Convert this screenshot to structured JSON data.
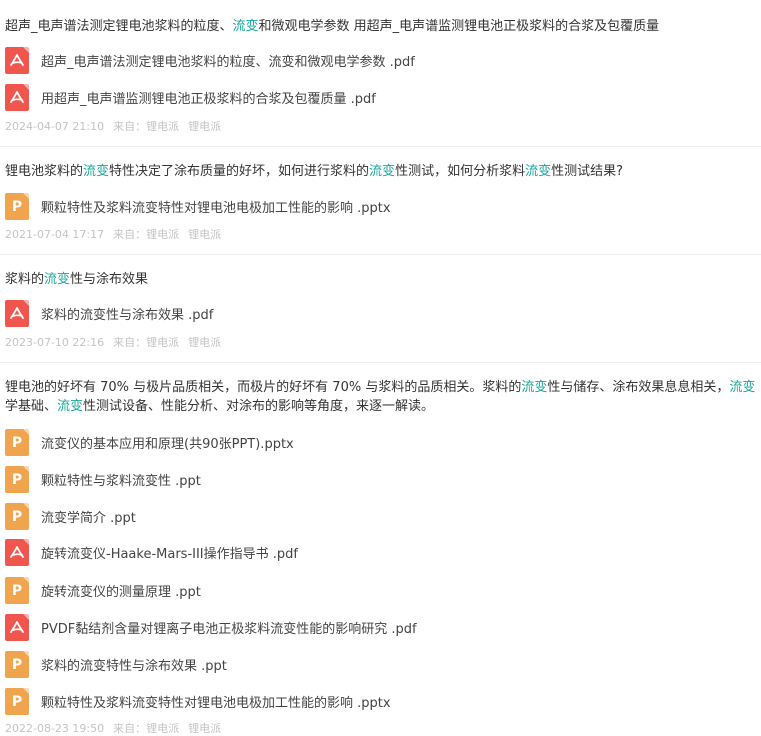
{
  "items": [
    {
      "title_parts": [
        "超声_电声谱法测定锂电池浆料的粒度、",
        "流变",
        "和微观电学参数 用超声_电声谱监测锂电池正极浆料的合浆及包覆质量"
      ],
      "files": [
        {
          "type": "pdf",
          "icon": "pdf-file-icon",
          "name": "超声_电声谱法测定锂电池浆料的粒度、流变和微观电学参数 .pdf"
        },
        {
          "type": "pdf",
          "icon": "pdf-file-icon",
          "name": "用超声_电声谱监测锂电池正极浆料的合浆及包覆质量 .pdf"
        }
      ],
      "date": "2024-04-07 21:10",
      "source_label": "来自：",
      "source": "锂电派",
      "author": "锂电派"
    },
    {
      "title_parts": [
        "锂电池浆料的",
        "流变",
        "特性决定了涂布质量的好坏，如何进行浆料的",
        "流变",
        "性测试，如何分析浆料",
        "流变",
        "性测试结果?"
      ],
      "files": [
        {
          "type": "ppt",
          "icon": "ppt-file-icon",
          "name": "颗粒特性及浆料流变特性对锂电池电极加工性能的影响 .pptx"
        }
      ],
      "date": "2021-07-04 17:17",
      "source_label": "来自：",
      "source": "锂电派",
      "author": "锂电派"
    },
    {
      "title_parts": [
        "浆料的",
        "流变",
        "性与涂布效果"
      ],
      "files": [
        {
          "type": "pdf",
          "icon": "pdf-file-icon",
          "name": "浆料的流变性与涂布效果 .pdf"
        }
      ],
      "date": "2023-07-10 22:16",
      "source_label": "来自：",
      "source": "锂电派",
      "author": "锂电派"
    },
    {
      "title_parts": [
        "锂电池的好坏有 70% 与极片品质相关，而极片的好坏有 70% 与浆料的品质相关。浆料的",
        "流变",
        "性与储存、涂布效果息息相关，",
        "流变",
        "学基础、",
        "流变",
        "性测试设备、性能分析、对涂布的影响等角度，来逐一解读。"
      ],
      "files": [
        {
          "type": "ppt",
          "icon": "ppt-file-icon",
          "name": "流变仪的基本应用和原理(共90张PPT).pptx"
        },
        {
          "type": "ppt",
          "icon": "ppt-file-icon",
          "name": "颗粒特性与浆料流变性 .ppt"
        },
        {
          "type": "ppt",
          "icon": "ppt-file-icon",
          "name": "流变学简介 .ppt"
        },
        {
          "type": "pdf",
          "icon": "pdf-file-icon",
          "name": "旋转流变仪-Haake-Mars-III操作指导书 .pdf"
        },
        {
          "type": "ppt",
          "icon": "ppt-file-icon",
          "name": "旋转流变仪的测量原理 .ppt"
        },
        {
          "type": "pdf",
          "icon": "pdf-file-icon",
          "name": "PVDF黏结剂含量对锂离子电池正极浆料流变性能的影响研究 .pdf"
        },
        {
          "type": "ppt",
          "icon": "ppt-file-icon",
          "name": "浆料的流变特性与涂布效果 .ppt"
        },
        {
          "type": "ppt",
          "icon": "ppt-file-icon",
          "name": "颗粒特性及浆料流变特性对锂电池电极加工性能的影响 .pptx"
        }
      ],
      "date": "2022-08-23 19:50",
      "source_label": "来自：",
      "source": "锂电派",
      "author": "锂电派"
    }
  ],
  "colors": {
    "highlight": "#1aa89a",
    "pdf": "#f0564d",
    "ppt": "#f0a44e",
    "meta": "#c4c4c4"
  }
}
